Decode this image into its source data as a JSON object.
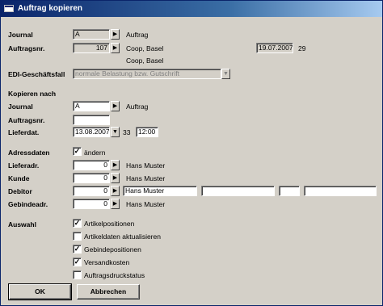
{
  "window": {
    "title": "Auftrag kopieren"
  },
  "source": {
    "journal_label": "Journal",
    "journal_value": "A",
    "journal_desc": "Auftrag",
    "auftragsnr_label": "Auftragsnr.",
    "auftragsnr_value": "107",
    "customer1": "Coop, Basel",
    "date": "19.07.2007",
    "week": "29",
    "customer2": "Coop, Basel",
    "edi_label": "EDI-Geschäftsfall",
    "edi_value": "normale Belastung bzw. Gutschrift"
  },
  "target": {
    "section_label": "Kopieren nach",
    "journal_label": "Journal",
    "journal_value": "A",
    "journal_desc": "Auftrag",
    "auftragsnr_label": "Auftragsnr.",
    "auftragsnr_value": "",
    "lieferdat_label": "Lieferdat.",
    "lieferdat_value": "13.08.2007",
    "week": "33",
    "time": "12:00"
  },
  "address": {
    "label": "Adressdaten",
    "change_label": "ändern",
    "change_checked": true,
    "rows": [
      {
        "label": "Lieferadr.",
        "value": "0",
        "name": "Hans Muster"
      },
      {
        "label": "Kunde",
        "value": "0",
        "name": "Hans Muster"
      },
      {
        "label": "Debitor",
        "value": "0",
        "name": "Hans Muster"
      },
      {
        "label": "Gebindeadr.",
        "value": "0",
        "name": "Hans Muster"
      }
    ]
  },
  "selection": {
    "label": "Auswahl",
    "options": [
      {
        "label": "Artikelpositionen",
        "checked": true
      },
      {
        "label": "Artikeldaten aktualisieren",
        "checked": false
      },
      {
        "label": "Gebindepositionen",
        "checked": true
      },
      {
        "label": "Versandkosten",
        "checked": true
      },
      {
        "label": "Auftragsdruckstatus",
        "checked": false
      }
    ]
  },
  "buttons": {
    "ok": "OK",
    "cancel": "Abbrechen"
  },
  "glyphs": {
    "arrow_right": "▶",
    "arrow_down": "▼",
    "check": "✓"
  }
}
